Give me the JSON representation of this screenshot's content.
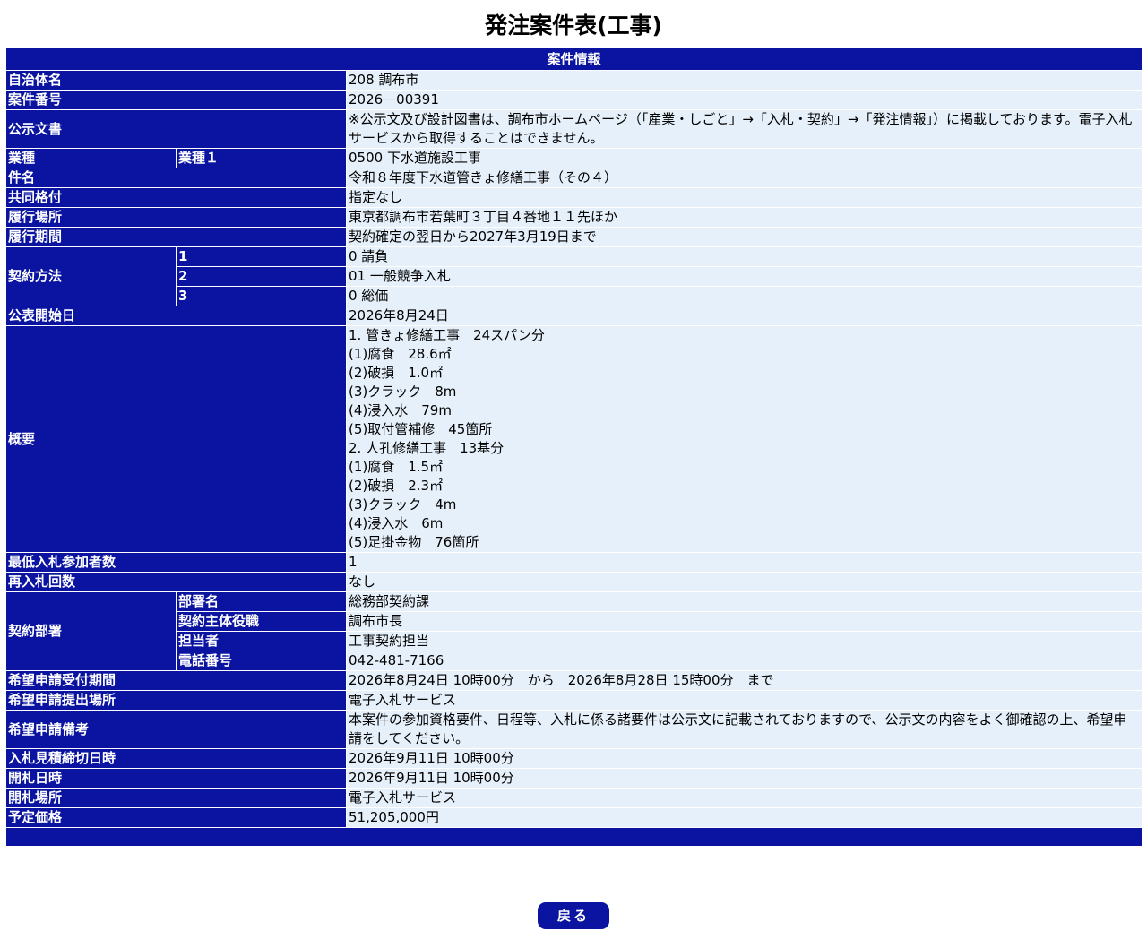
{
  "page_title": "発注案件表(工事)",
  "section_title": "案件情報",
  "rows": {
    "municipality": {
      "label": "自治体名",
      "value": "208 調布市"
    },
    "case_number": {
      "label": "案件番号",
      "value": "2026－00391"
    },
    "public_notice": {
      "label": "公示文書",
      "value": "※公示文及び設計図書は、調布市ホームページ（「産業・しごと」→「入札・契約」→「発注情報」）に掲載しております。電子入札サービスから取得することはできません。"
    },
    "industry": {
      "label": "業種",
      "sublabel": "業種１",
      "value": "0500 下水道施設工事"
    },
    "subject": {
      "label": "件名",
      "value": "令和８年度下水道管きょ修繕工事（その４）"
    },
    "joint_rating": {
      "label": "共同格付",
      "value": "指定なし"
    },
    "location": {
      "label": "履行場所",
      "value": "東京都調布市若葉町３丁目４番地１１先ほか"
    },
    "period": {
      "label": "履行期間",
      "value": "契約確定の翌日から2027年3月19日まで"
    },
    "contract_method": {
      "label": "契約方法",
      "items": [
        {
          "no": "1",
          "value": "0 請負"
        },
        {
          "no": "2",
          "value": "01 一般競争入札"
        },
        {
          "no": "3",
          "value": "0 総価"
        }
      ]
    },
    "publish_start": {
      "label": "公表開始日",
      "value": "2026年8月24日"
    },
    "overview": {
      "label": "概要",
      "lines": [
        "1. 管きょ修繕工事　24スパン分",
        "(1)腐食　28.6㎡",
        "(2)破損　1.0㎡",
        "(3)クラック　8m",
        "(4)浸入水　79m",
        "(5)取付管補修　45箇所",
        "2. 人孔修繕工事　13基分",
        "(1)腐食　1.5㎡",
        "(2)破損　2.3㎡",
        "(3)クラック　4m",
        "(4)浸入水　6m",
        "(5)足掛金物　76箇所"
      ]
    },
    "min_bidders": {
      "label": "最低入札参加者数",
      "value": "1"
    },
    "rebid_count": {
      "label": "再入札回数",
      "value": "なし"
    },
    "contract_dept": {
      "label": "契約部署",
      "items": [
        {
          "label": "部署名",
          "value": "総務部契約課"
        },
        {
          "label": "契約主体役職",
          "value": "調布市長"
        },
        {
          "label": "担当者",
          "value": "工事契約担当"
        },
        {
          "label": "電話番号",
          "value": "042-481-7166"
        }
      ]
    },
    "application_period": {
      "label": "希望申請受付期間",
      "value": "2026年8月24日 10時00分　から　2026年8月28日 15時00分　まで"
    },
    "application_place": {
      "label": "希望申請提出場所",
      "value": "電子入札サービス"
    },
    "application_note": {
      "label": "希望申請備考",
      "value": "本案件の参加資格要件、日程等、入札に係る諸要件は公示文に記載されておりますので、公示文の内容をよく御確認の上、希望申請をしてください。"
    },
    "bid_deadline": {
      "label": "入札見積締切日時",
      "value": "2026年9月11日 10時00分"
    },
    "opening_datetime": {
      "label": "開札日時",
      "value": "2026年9月11日 10時00分"
    },
    "opening_place": {
      "label": "開札場所",
      "value": "電子入札サービス"
    },
    "estimated_price": {
      "label": "予定価格",
      "value": "51,205,000円"
    }
  },
  "back_button": "戻る",
  "colors": {
    "header_bg": "#0a14a0",
    "value_bg": "#e6f0fa"
  }
}
